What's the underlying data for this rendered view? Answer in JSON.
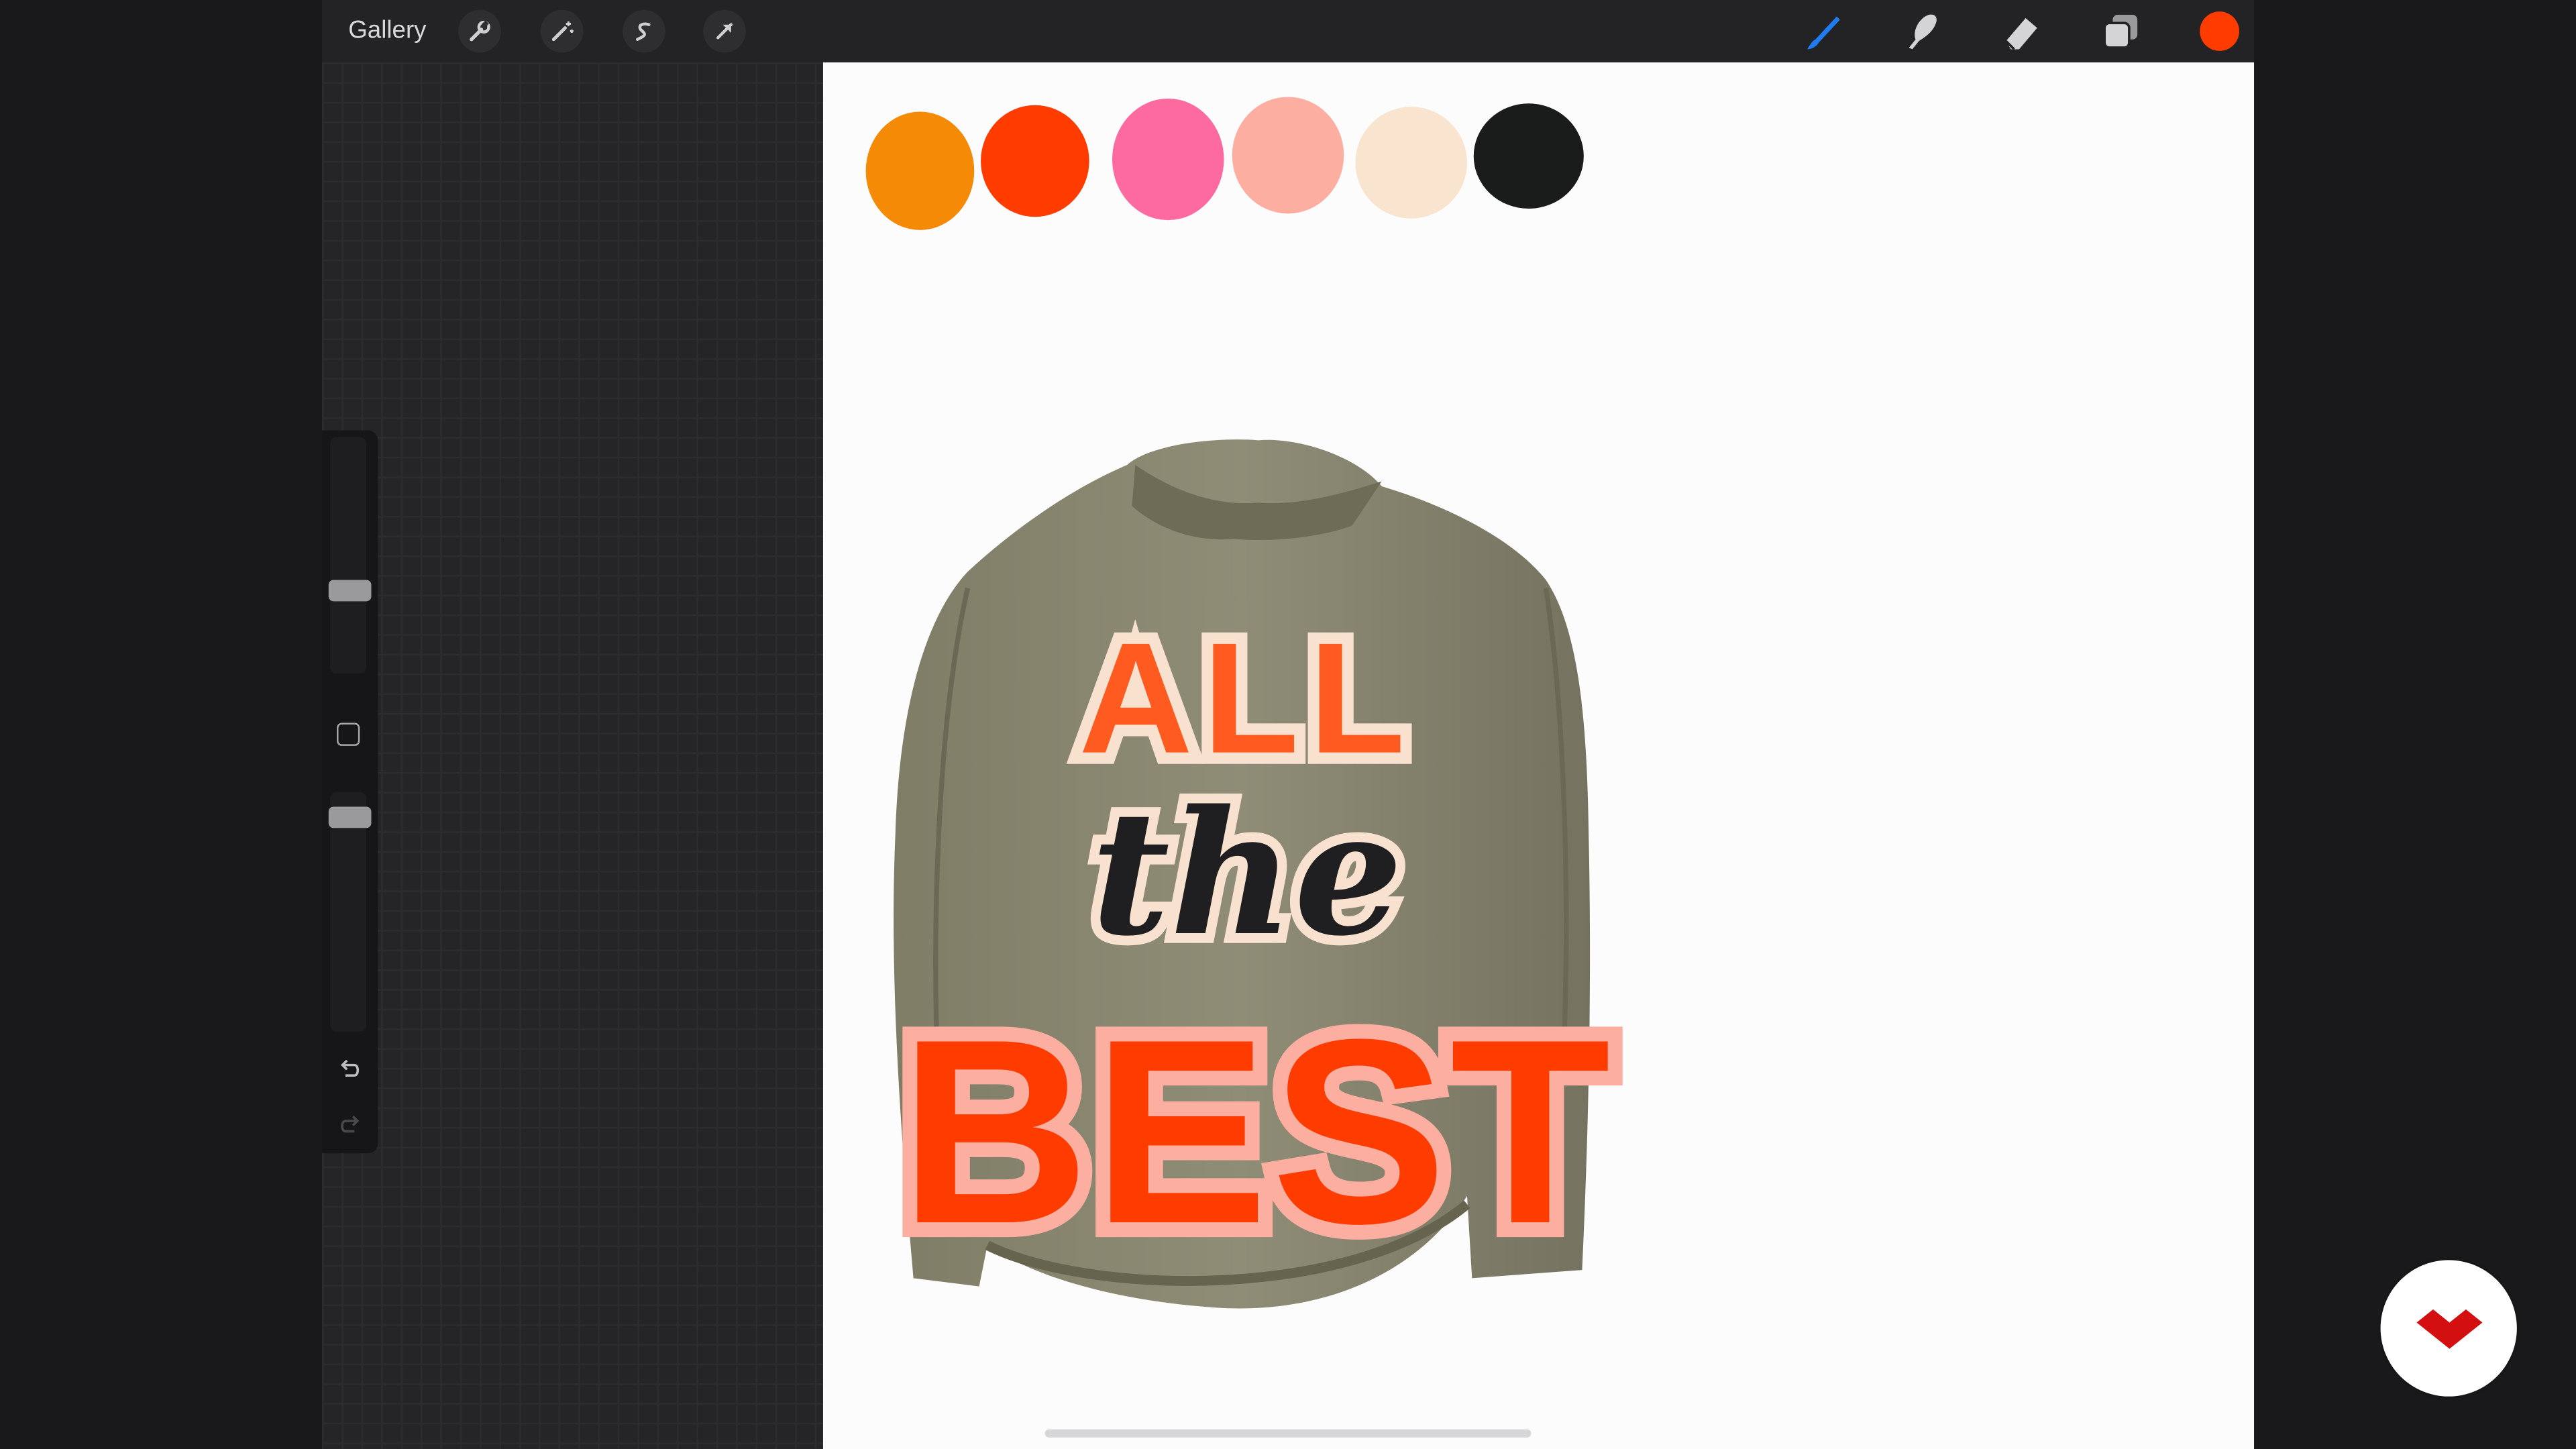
{
  "toolbar": {
    "gallery_label": "Gallery",
    "left_tools": [
      "wrench-icon",
      "magic-wand-icon",
      "selection-icon",
      "transform-arrow-icon"
    ],
    "right_tools": [
      "brush-icon",
      "smudge-icon",
      "eraser-icon",
      "layers-icon"
    ],
    "active_color": "#ff3c00"
  },
  "sidebar": {
    "size_slider_level": 0.38,
    "opacity_slider_level": 0.06,
    "icons": [
      "modify-button-icon",
      "undo-icon",
      "redo-icon"
    ]
  },
  "canvas": {
    "palette": [
      "#f58a07",
      "#ff3c00",
      "#fd6aa0",
      "#fcaea1",
      "#f9e4cf",
      "#1a1c1c"
    ],
    "artwork": {
      "subject": "olive-jacket",
      "lettering_lines": [
        "ALL",
        "the",
        "BEST"
      ]
    }
  },
  "brand": {
    "badge_color": "#d40f0f"
  }
}
